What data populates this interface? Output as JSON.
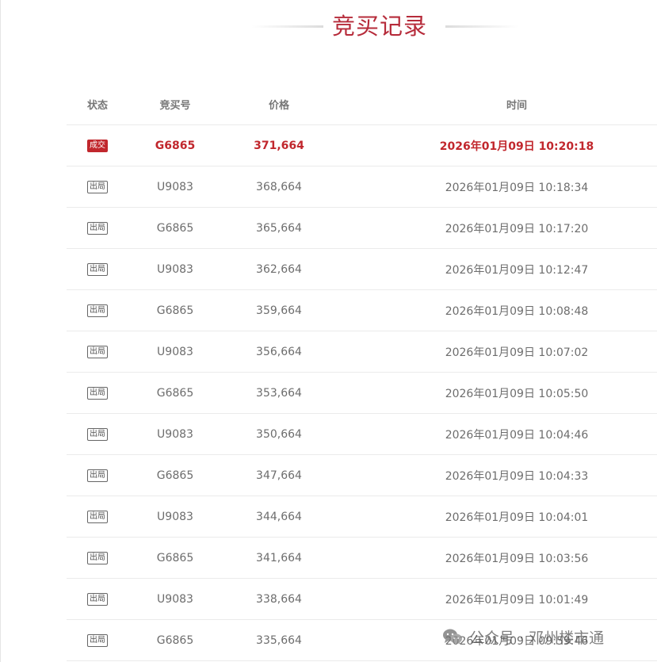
{
  "page": {
    "title": "竞买记录"
  },
  "table": {
    "headers": {
      "status": "状态",
      "bidder": "竞买号",
      "price": "价格",
      "time": "时间"
    },
    "rows": [
      {
        "status": "成交",
        "bidder": "G6865",
        "price": "371,664",
        "time": "2026年01月09日 10:20:18"
      },
      {
        "status": "出局",
        "bidder": "U9083",
        "price": "368,664",
        "time": "2026年01月09日 10:18:34"
      },
      {
        "status": "出局",
        "bidder": "G6865",
        "price": "365,664",
        "time": "2026年01月09日 10:17:20"
      },
      {
        "status": "出局",
        "bidder": "U9083",
        "price": "362,664",
        "time": "2026年01月09日 10:12:47"
      },
      {
        "status": "出局",
        "bidder": "G6865",
        "price": "359,664",
        "time": "2026年01月09日 10:08:48"
      },
      {
        "status": "出局",
        "bidder": "U9083",
        "price": "356,664",
        "time": "2026年01月09日 10:07:02"
      },
      {
        "status": "出局",
        "bidder": "G6865",
        "price": "353,664",
        "time": "2026年01月09日 10:05:50"
      },
      {
        "status": "出局",
        "bidder": "U9083",
        "price": "350,664",
        "time": "2026年01月09日 10:04:46"
      },
      {
        "status": "出局",
        "bidder": "G6865",
        "price": "347,664",
        "time": "2026年01月09日 10:04:33"
      },
      {
        "status": "出局",
        "bidder": "U9083",
        "price": "344,664",
        "time": "2026年01月09日 10:04:01"
      },
      {
        "status": "出局",
        "bidder": "G6865",
        "price": "341,664",
        "time": "2026年01月09日 10:03:56"
      },
      {
        "status": "出局",
        "bidder": "U9083",
        "price": "338,664",
        "time": "2026年01月09日 10:01:49"
      },
      {
        "status": "出局",
        "bidder": "G6865",
        "price": "335,664",
        "time": "2026年01月09日 09:59:46"
      }
    ]
  },
  "watermark": {
    "text": "公众号 · 邓州楼市通",
    "icon": "wechat-icon"
  },
  "colors": {
    "accent": "#b62b3a",
    "win": "#c1272d",
    "text": "#6d6d6d"
  }
}
